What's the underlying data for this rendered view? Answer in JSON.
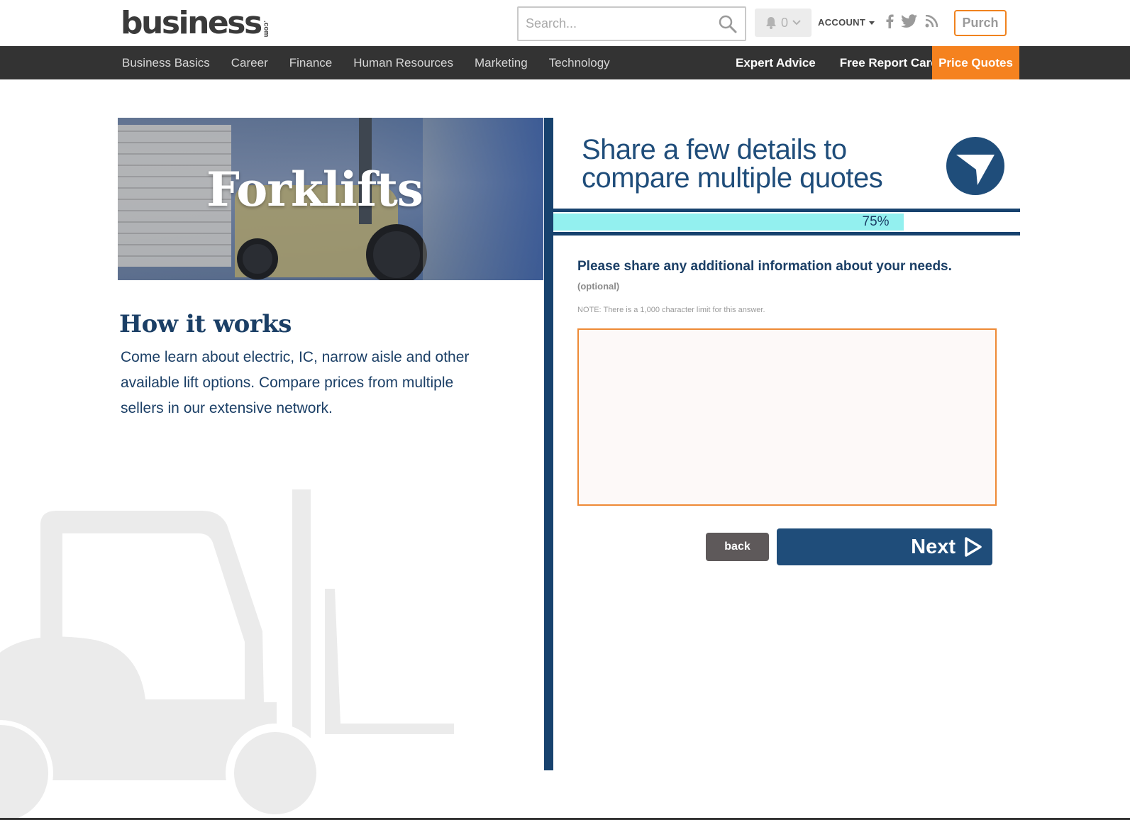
{
  "header": {
    "logo_text": "business",
    "logo_suffix": ".com",
    "search_placeholder": "Search...",
    "notification_count": "0",
    "account_label": "ACCOUNT",
    "purch_label": "Purch"
  },
  "nav": {
    "items": [
      {
        "label": "Business Basics"
      },
      {
        "label": "Career"
      },
      {
        "label": "Finance"
      },
      {
        "label": "Human Resources"
      },
      {
        "label": "Marketing"
      },
      {
        "label": "Technology"
      }
    ],
    "expert_advice": "Expert Advice",
    "free_report_card": "Free Report Card",
    "price_quotes": "Price Quotes"
  },
  "hero": {
    "title": "Forklifts"
  },
  "how_it_works": {
    "title": "How it works",
    "text": "Come learn about electric, IC, narrow aisle and other available lift options. Compare prices from multiple sellers in our extensive network."
  },
  "form": {
    "title": "Share a few details to compare multiple quotes",
    "progress_percent": 75,
    "progress_label": "75%",
    "question": "Please share any additional information about your needs.",
    "optional": "(optional)",
    "note": "NOTE: There is a 1,000 character limit for this answer.",
    "answer_value": "",
    "back_label": "back",
    "next_label": "Next"
  },
  "colors": {
    "navy": "#1f4d7a",
    "divider": "#17426e",
    "orange": "#f5821f",
    "progress_fill": "#93f0ef",
    "navbar": "#333333"
  },
  "icons": {
    "search": "search-icon",
    "bell": "bell-icon",
    "facebook": "facebook-icon",
    "twitter": "twitter-icon",
    "rss": "rss-icon",
    "badge": "arrow-down-icon",
    "next": "play-arrow-icon"
  }
}
